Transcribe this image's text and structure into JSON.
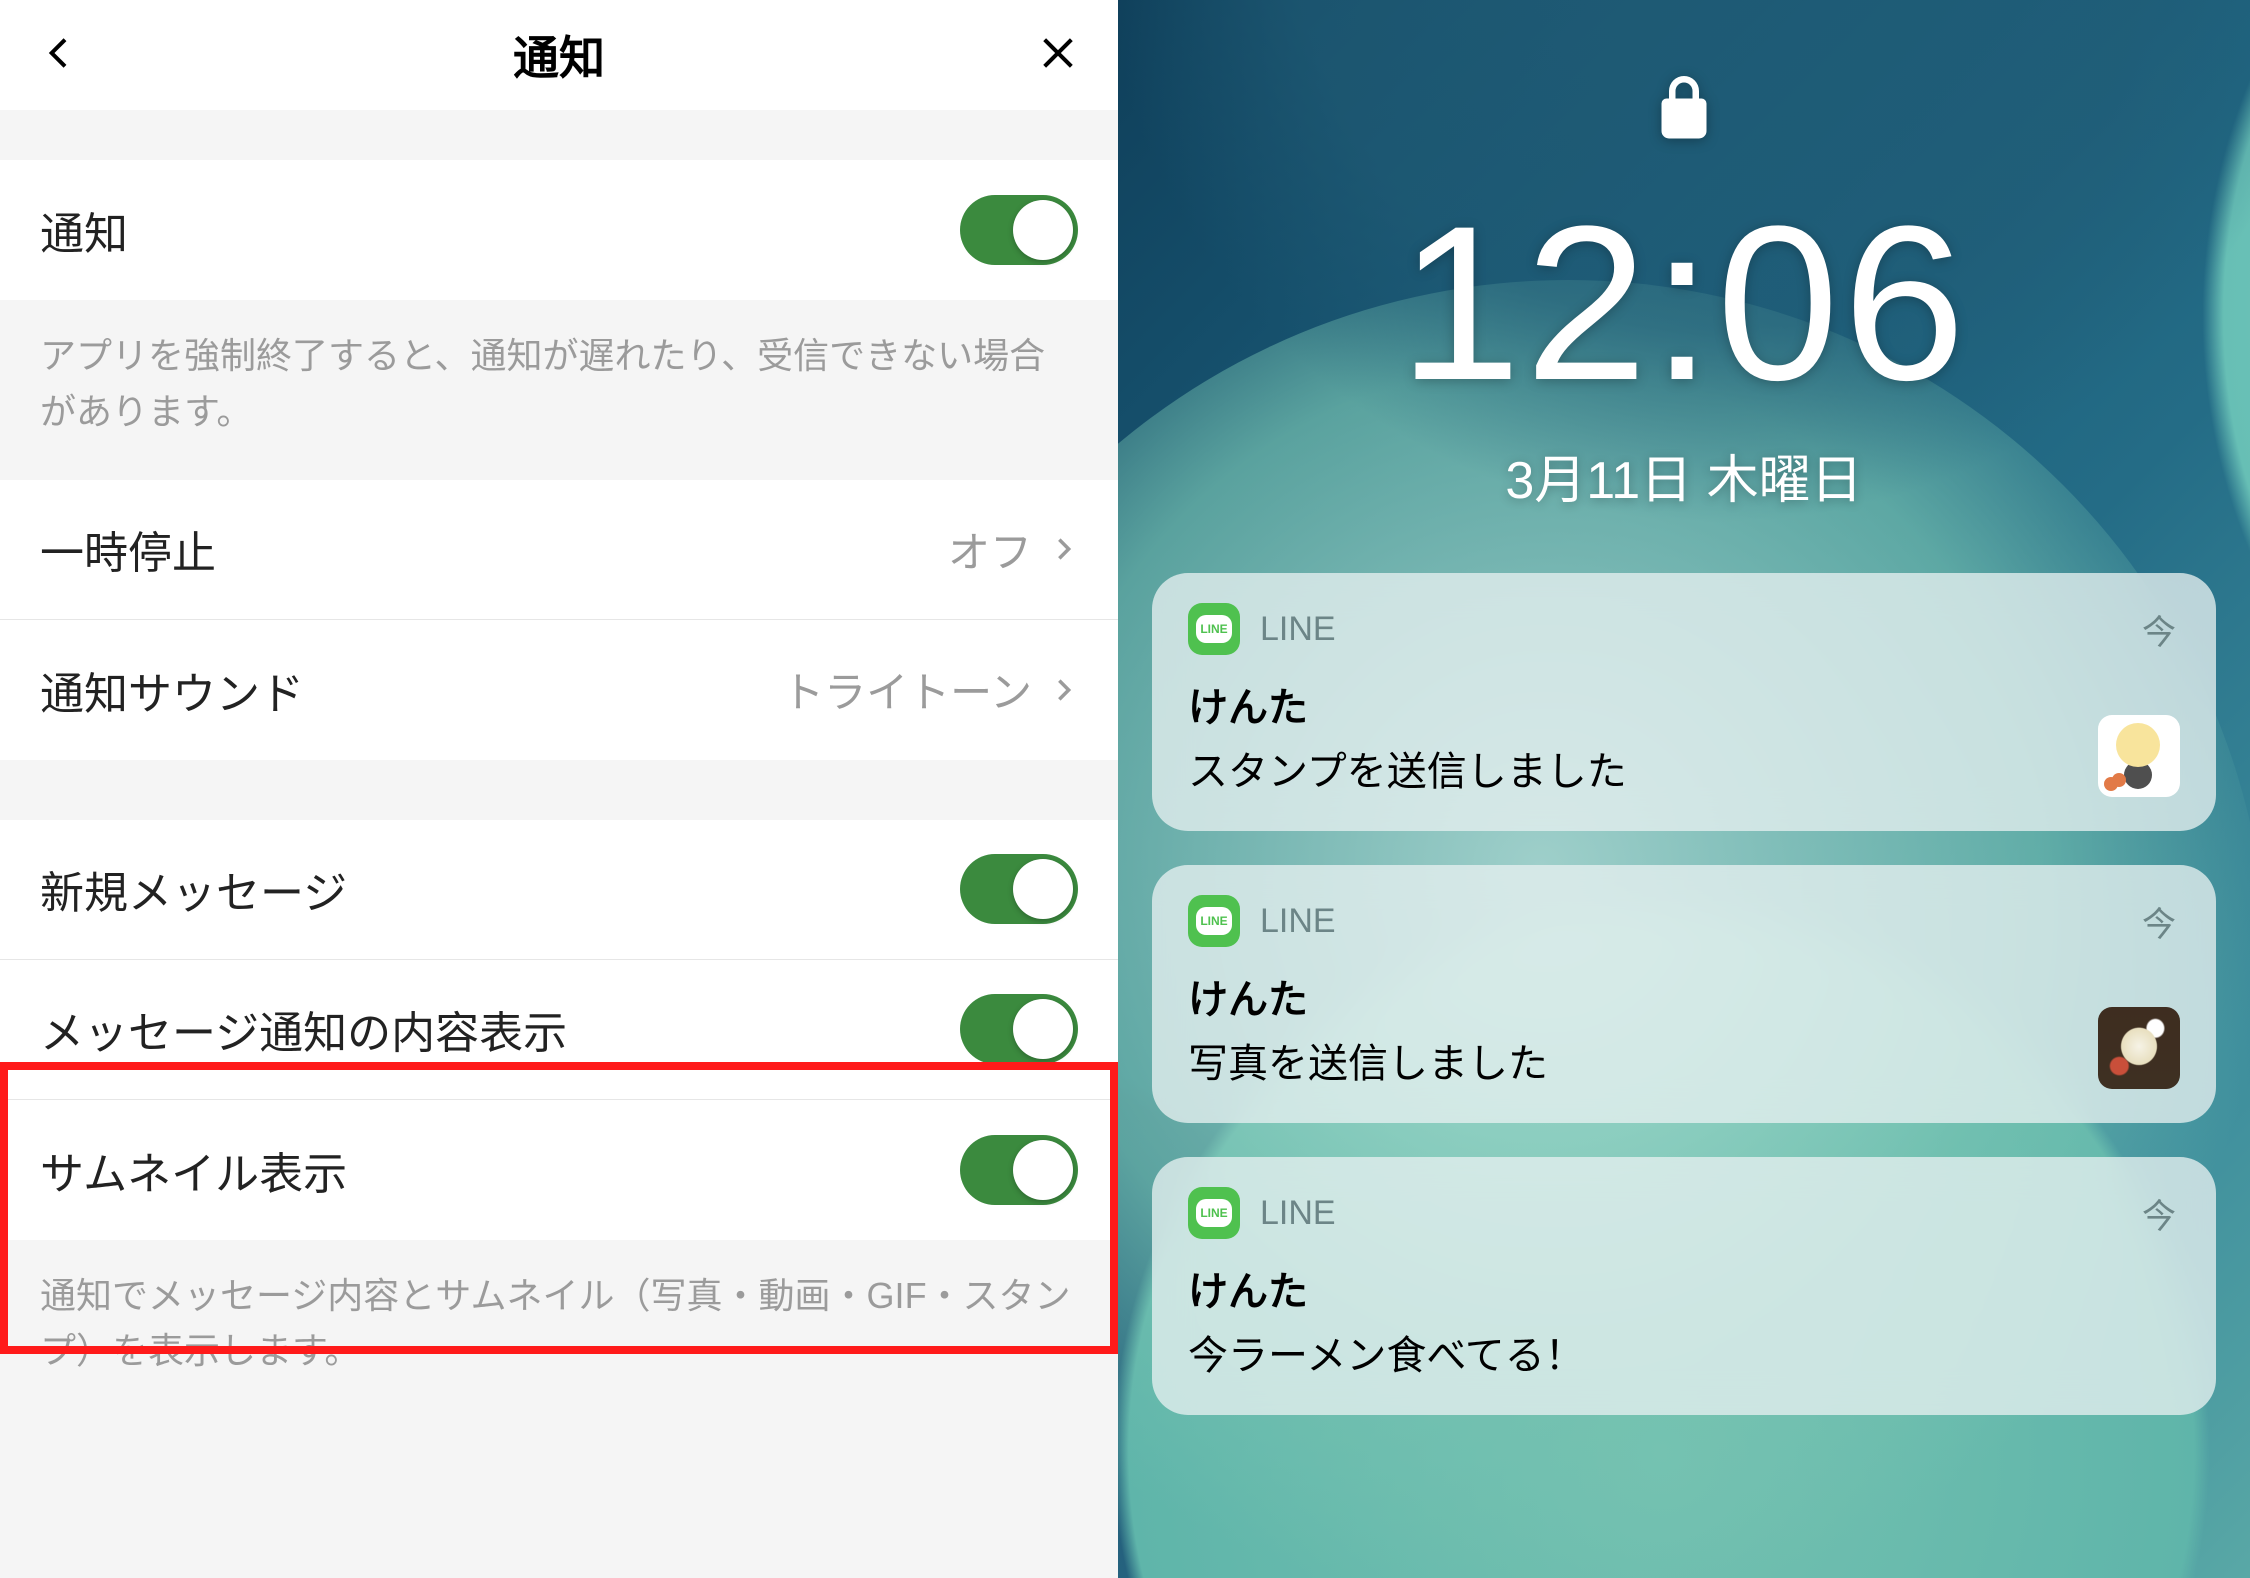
{
  "settings": {
    "title": "通知",
    "notice_toggle_label": "通知",
    "notice_description": "アプリを強制終了すると、通知が遅れたり、受信できない場合があります。",
    "pause_label": "一時停止",
    "pause_value": "オフ",
    "sound_label": "通知サウンド",
    "sound_value": "トライトーン",
    "newmsg_label": "新規メッセージ",
    "content_label": "メッセージ通知の内容表示",
    "thumb_label": "サムネイル表示",
    "thumb_description": "通知でメッセージ内容とサムネイル（写真・動画・GIF・スタンプ）を表示します。"
  },
  "lockscreen": {
    "time": "12:06",
    "date": "3月11日 木曜日",
    "notifications": [
      {
        "app": "LINE",
        "time": "今",
        "sender": "けんた",
        "message": "スタンプを送信しました",
        "thumb": "sticker"
      },
      {
        "app": "LINE",
        "time": "今",
        "sender": "けんた",
        "message": "写真を送信しました",
        "thumb": "photo"
      },
      {
        "app": "LINE",
        "time": "今",
        "sender": "けんた",
        "message": "今ラーメン食べてる！",
        "thumb": null
      }
    ]
  }
}
